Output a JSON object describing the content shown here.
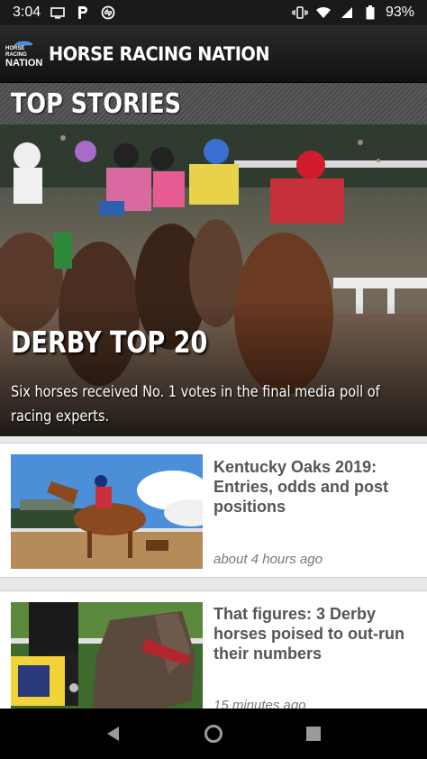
{
  "status_bar": {
    "time": "3:04",
    "battery": "93%",
    "icons": [
      "screen-icon",
      "parking-icon",
      "sync-icon",
      "vibrate-icon",
      "wifi-icon",
      "signal-icon",
      "battery-icon"
    ]
  },
  "app": {
    "logo_top": "HORSE RACING",
    "logo_bottom": "NATION",
    "title": "HORSE RACING NATION"
  },
  "section": {
    "title": "TOP STORIES"
  },
  "hero": {
    "headline": "DERBY TOP 20",
    "subtitle": "Six horses received No. 1 votes in the final media poll of racing experts."
  },
  "stories": [
    {
      "title": "Kentucky Oaks 2019: Entries, odds and post positions",
      "time": "about 4 hours ago"
    },
    {
      "title": "That figures: 3 Derby horses poised to out-run their numbers",
      "time": "15 minutes ago"
    }
  ],
  "nav": {
    "icons": [
      "back-icon",
      "home-icon",
      "recents-icon"
    ]
  },
  "colors": {
    "header_bg": "#1f1f1f",
    "section_bg": "#555555",
    "card_bg": "#ffffff",
    "story_title": "#555555"
  }
}
